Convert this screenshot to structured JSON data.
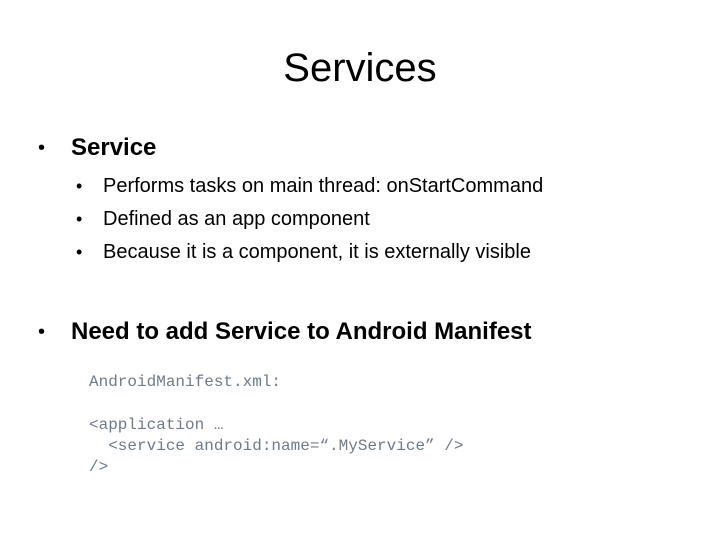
{
  "slide": {
    "title": "Services",
    "bullets": [
      {
        "text": "Service",
        "sub_bullets": [
          "Performs tasks on main thread: onStartCommand",
          "Defined as an app component",
          "Because it is a component, it is externally visible"
        ]
      },
      {
        "text": "Need to add Service to Android Manifest"
      }
    ],
    "code": {
      "filename": "AndroidManifest.xml:",
      "lines": [
        "<application …",
        "  <service android:name=“.MyService” />",
        "/>"
      ]
    },
    "bullet_glyph": "•",
    "colors": {
      "text": "#000000",
      "code": "#6e7b8b",
      "background": "#ffffff"
    }
  }
}
